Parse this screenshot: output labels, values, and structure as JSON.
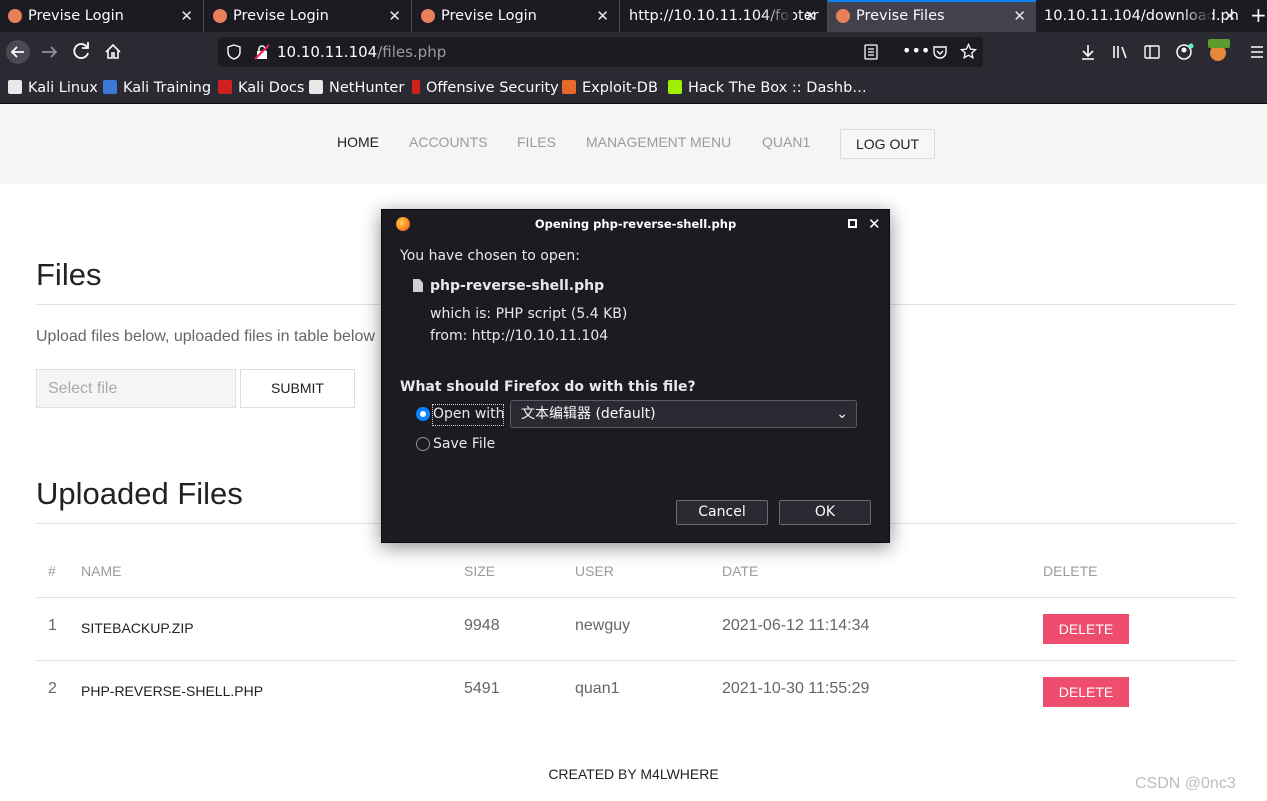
{
  "browser": {
    "tabs": [
      {
        "label": "Previse Login",
        "close": "✕"
      },
      {
        "label": "Previse Login",
        "close": "✕"
      },
      {
        "label": "Previse Login",
        "close": "✕"
      },
      {
        "label": "http://10.10.11.104/footer",
        "close": "✕"
      },
      {
        "label": "Previse Files",
        "close": "✕"
      },
      {
        "label": "10.10.11.104/download.ph",
        "close": "✕"
      }
    ],
    "new_tab": "+",
    "url_host": "10.10.11.104",
    "url_path": "/files.php",
    "bookmarks": [
      {
        "label": "Kali Linux",
        "color": "#e8e8e8"
      },
      {
        "label": "Kali Training",
        "color": "#3b79d6"
      },
      {
        "label": "Kali Docs",
        "color": "#d02020"
      },
      {
        "label": "NetHunter",
        "color": "#e8e8e8"
      },
      {
        "label": "Offensive Security",
        "color": "#d02020"
      },
      {
        "label": "Exploit-DB",
        "color": "#e86a2a"
      },
      {
        "label": "Hack The Box :: Dashb…",
        "color": "#9fef00"
      }
    ]
  },
  "site": {
    "nav": {
      "home": "HOME",
      "accounts": "ACCOUNTS",
      "files": "FILES",
      "management": "MANAGEMENT MENU",
      "user": "QUAN1",
      "logout": "LOG OUT"
    },
    "files_title": "Files",
    "upload_desc": "Upload files below, uploaded files in table below",
    "file_placeholder": "Select file",
    "submit_label": "SUBMIT",
    "uploaded_title": "Uploaded Files",
    "table": {
      "headers": [
        "#",
        "NAME",
        "SIZE",
        "USER",
        "DATE",
        "DELETE"
      ],
      "rows": [
        {
          "num": "1",
          "name": "SITEBACKUP.ZIP",
          "size": "9948",
          "user": "newguy",
          "date": "2021-06-12 11:14:34",
          "action": "DELETE"
        },
        {
          "num": "2",
          "name": "PHP-REVERSE-SHELL.PHP",
          "size": "5491",
          "user": "quan1",
          "date": "2021-10-30 11:55:29",
          "action": "DELETE"
        }
      ]
    },
    "footer": "CREATED BY M4LWHERE",
    "accent_color": "#ef4d6d"
  },
  "dialog": {
    "title": "Opening php-reverse-shell.php",
    "chosen_label": "You have chosen to open:",
    "file_name": "php-reverse-shell.php",
    "which_is": "which is:  PHP script (5.4 KB)",
    "from": "from:  http://10.10.11.104",
    "question": "What should Firefox do with this file?",
    "open_with_label": "Open with",
    "open_with_app": "文本编辑器 (default)",
    "save_file_label": "Save File",
    "cancel_label": "Cancel",
    "ok_label": "OK"
  },
  "watermark": "CSDN @0nc3"
}
